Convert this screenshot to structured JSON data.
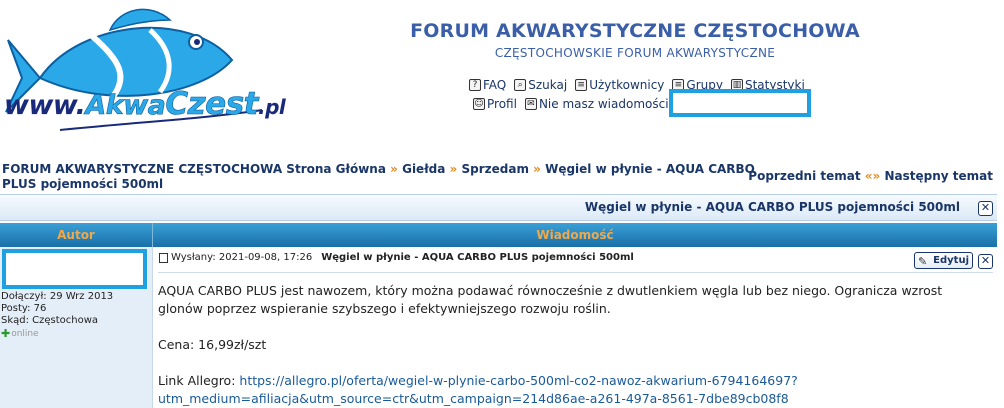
{
  "header": {
    "logo": {
      "www": "www.",
      "akwa": "Akwa",
      "czest": "Czest",
      "pl": ".pl"
    },
    "title": "FORUM AKWARYSTYCZNE CZĘSTOCHOWA",
    "subtitle": "CZĘSTOCHOWSKIE FORUM AKWARYSTYCZNE",
    "nav_row1": [
      {
        "label": "FAQ",
        "icon": "question-icon"
      },
      {
        "label": "Szukaj",
        "icon": "magnifier-icon"
      },
      {
        "label": "Użytkownicy",
        "icon": "list-icon"
      },
      {
        "label": "Grupy",
        "icon": "group-icon"
      },
      {
        "label": "Statystyki",
        "icon": "stats-icon"
      }
    ],
    "nav_row2": [
      {
        "label": "Profil",
        "icon": "profile-icon"
      },
      {
        "label": "Nie masz wiadomości",
        "icon": "message-icon"
      }
    ]
  },
  "breadcrumb": {
    "items": [
      "FORUM AKWARYSTYCZNE CZĘSTOCHOWA Strona Główna",
      "Giełda",
      "Sprzedam",
      "Węgiel w płynie - AQUA CARBO PLUS pojemności 500ml"
    ],
    "separator": "»"
  },
  "topic_nav": {
    "prev": "Poprzedni temat",
    "separator": "«»",
    "next": "Następny temat"
  },
  "topic_bar": {
    "title": "Węgiel w płynie - AQUA CARBO PLUS pojemności 500ml",
    "close_glyph": "✕"
  },
  "columns": {
    "author": "Autor",
    "message": "Wiadomość"
  },
  "post": {
    "author": {
      "joined": "Dołączył: 29 Wrz 2013",
      "posts": "Posty: 76",
      "from": "Skąd: Częstochowa",
      "status": "online"
    },
    "sent_label": "Wysłany: 2021-09-08, 17:26",
    "subject": "Węgiel w płynie - AQUA CARBO PLUS pojemności 500ml",
    "edit_label": "Edytuj",
    "close_glyph": "✕",
    "paragraph1": "AQUA CARBO PLUS jest nawozem, który można podawać równocześnie z dwutlenkiem węgla lub bez niego. Ogranicza wzrost glonów poprzez wspieranie szybszego i efektywniejszego rozwoju roślin.",
    "price": "Cena: 16,99zł/szt",
    "link_label": "Link Allegro: ",
    "link_url": "https://allegro.pl/oferta/wegiel-w-plynie-carbo-500ml-co2-nawoz-akwarium-6794164697?utm_medium=afiliacja&utm_source=ctr&utm_campaign=214d86ae-a261-497a-8561-7dbe89cb08f8"
  },
  "colors": {
    "accent_blue": "#3a5fa8",
    "header_blue": "#1a6fa8",
    "column_text": "#f0a848",
    "separator_orange": "#e28a1e",
    "redaction_blue": "#1fa0e0"
  }
}
